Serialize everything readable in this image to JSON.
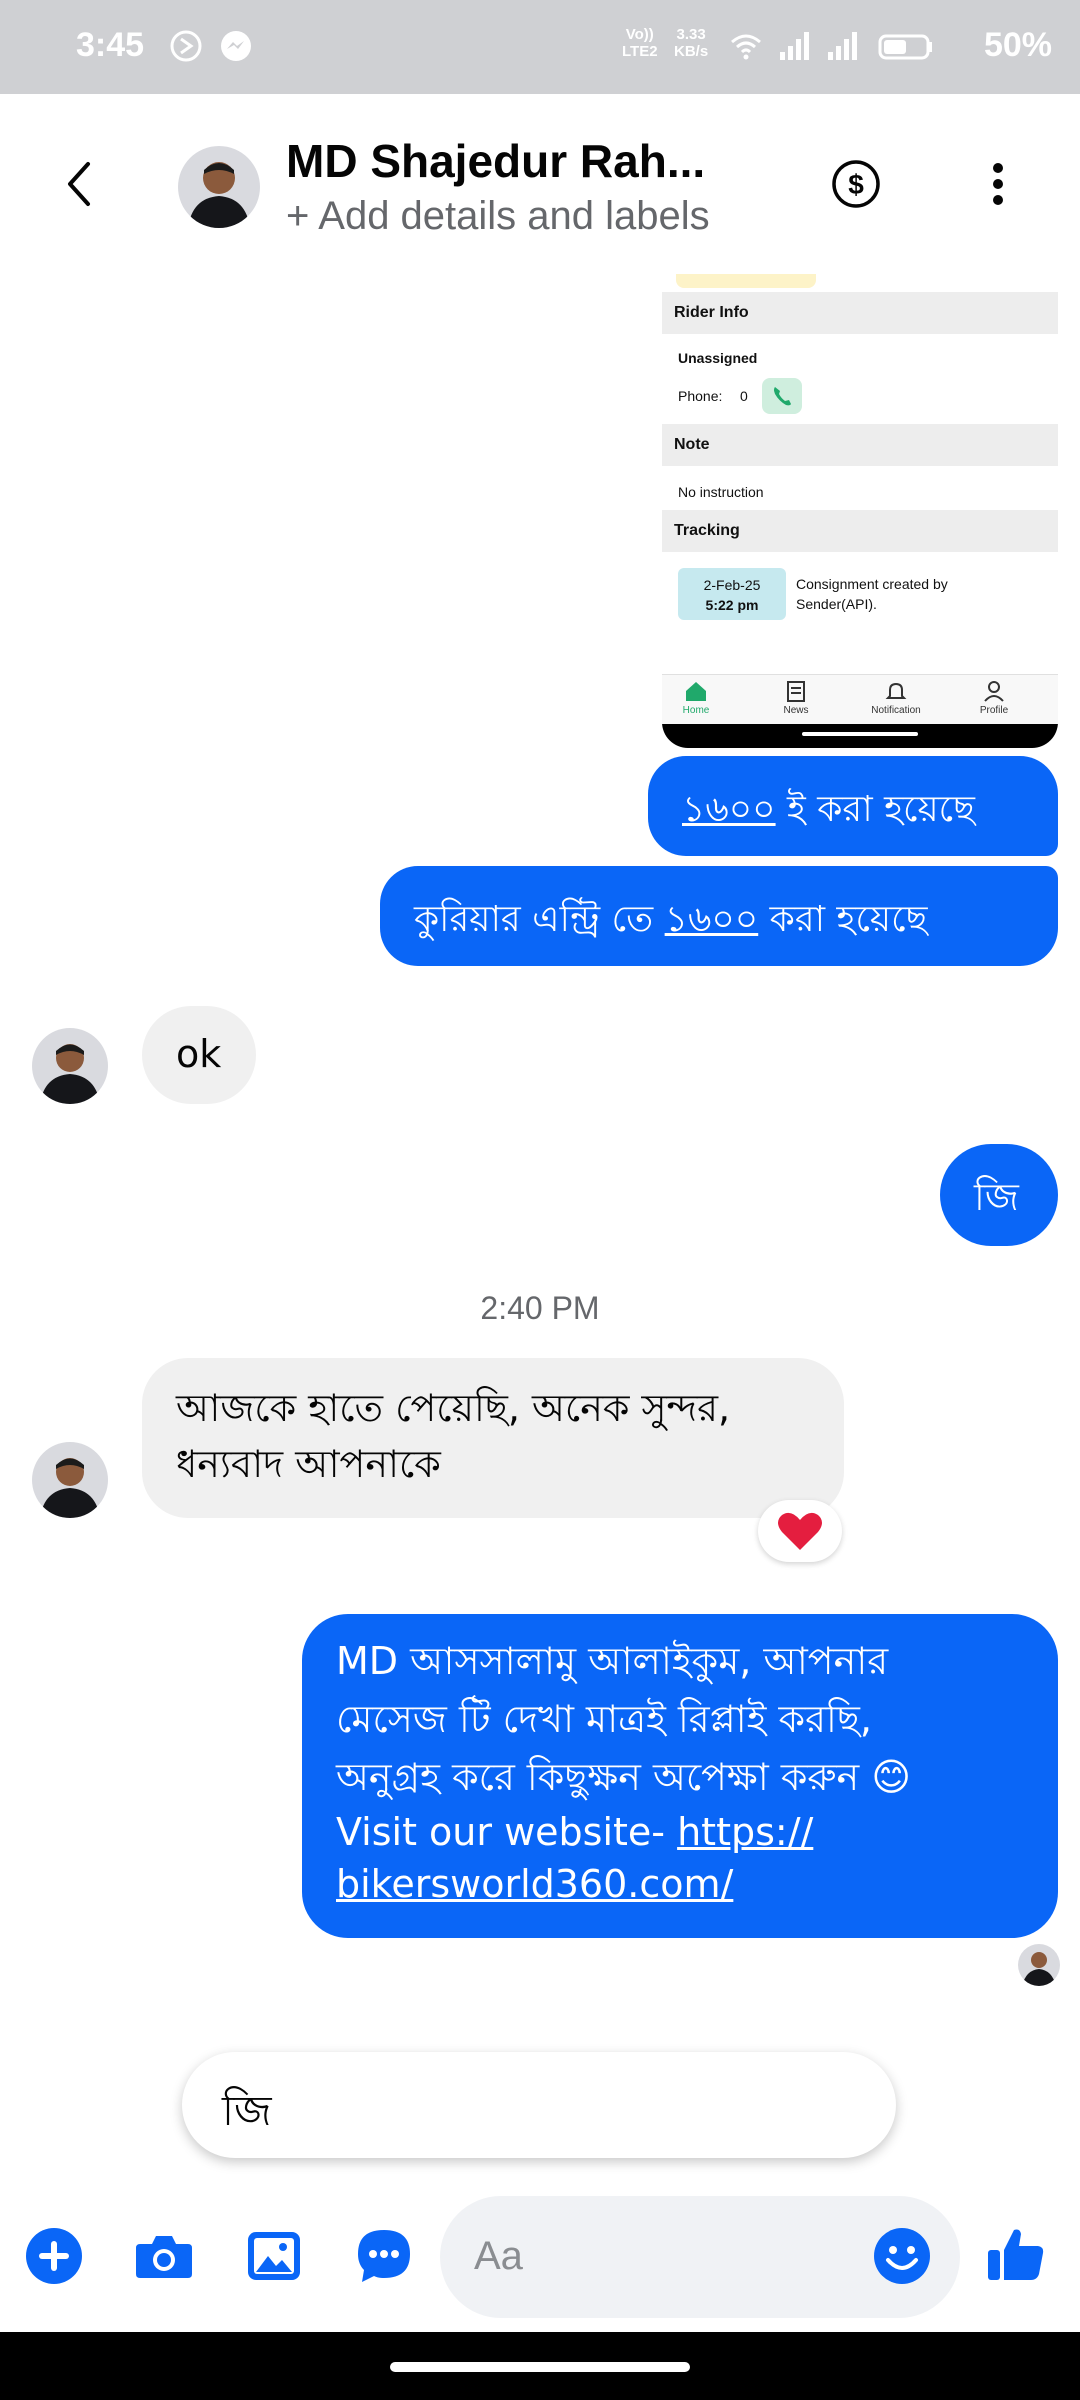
{
  "status_bar": {
    "time": "3:45",
    "network_top": "Vo))",
    "network_bottom": "LTE2",
    "speed_value": "3.33",
    "speed_unit": "KB/s",
    "battery": "50%"
  },
  "header": {
    "contact_name": "MD Shajedur Rah...",
    "subtitle": "+ Add details and labels"
  },
  "shared_image": {
    "rider_info_label": "Rider Info",
    "unassigned_label": "Unassigned",
    "phone_label": "Phone:",
    "phone_value": "0",
    "note_label": "Note",
    "note_value": "No instruction",
    "tracking_label": "Tracking",
    "tracking_date": "2-Feb-25",
    "tracking_time": "5:22 pm",
    "tracking_text_1": "Consignment created by",
    "tracking_text_2": "Sender(API).",
    "tabs": [
      "Home",
      "News",
      "Notification",
      "Profile"
    ]
  },
  "messages": {
    "m1_amount": "১৬০০",
    "m1_rest": " ই করা হয়েছে",
    "m2_prefix": "কুরিয়ার এন্ট্রি তে ",
    "m2_amount": "১৬০০",
    "m2_rest": " করা হয়েছে",
    "m3": "ok",
    "m4": "জি",
    "timestamp": "2:40 PM",
    "m5_line1": "আজকে হাতে পেয়েছি, অনেক সুন্দর,",
    "m5_line2": "ধন্যবাদ আপনাকে",
    "m6_line1": "MD আসসালামু আলাইকুম, আপনার",
    "m6_line2": "মেসেজ টি দেখা মাত্রই রিপ্লাই করছি,",
    "m6_line3": "অনুগ্রহ করে কিছুক্ষন অপেক্ষা করুন 😊",
    "m6_line4_prefix": "Visit our website- ",
    "m6_link_part1": "https://",
    "m6_link_part2": "bikersworld360.com/"
  },
  "suggestion": "জি",
  "composer": {
    "placeholder": "Aa"
  },
  "colors": {
    "accent": "#0a66f7",
    "incoming_bubble": "#f0f0f0",
    "status_bar_bg": "#cfd0d3"
  }
}
